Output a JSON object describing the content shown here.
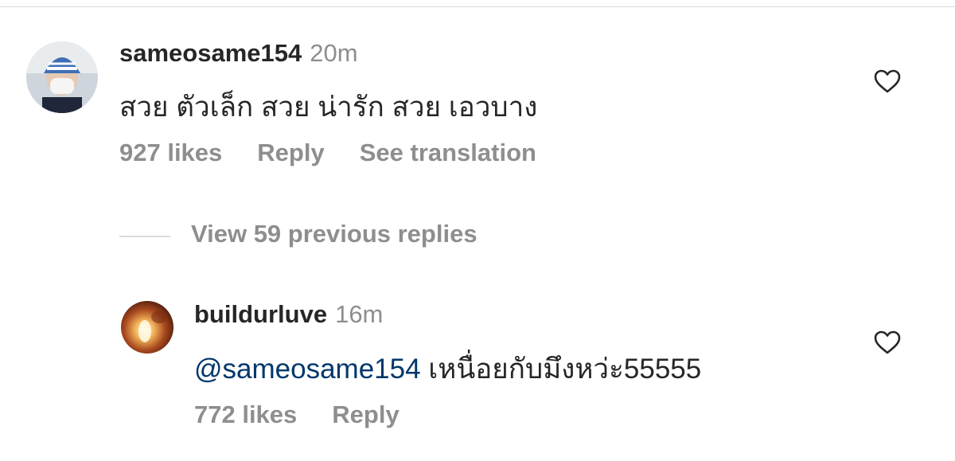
{
  "comments": [
    {
      "username": "sameosame154",
      "time": "20m",
      "text": "สวย ตัวเล็ก สวย น่ารัก สวย เอวบาง",
      "likes": "927 likes",
      "reply_label": "Reply",
      "translation_label": "See translation"
    }
  ],
  "view_replies_label": "View 59 previous replies",
  "replies": [
    {
      "username": "buildurluve",
      "time": "16m",
      "mention": "@sameosame154",
      "text": " เหนื่อยกับมึงหว่ะ55555",
      "likes": "772 likes",
      "reply_label": "Reply"
    }
  ],
  "icons": {
    "like": "heart-outline-icon"
  },
  "colors": {
    "primary_text": "#262626",
    "secondary_text": "#8e8e8e",
    "mention": "#00376b",
    "divider": "#dbdbdb"
  }
}
